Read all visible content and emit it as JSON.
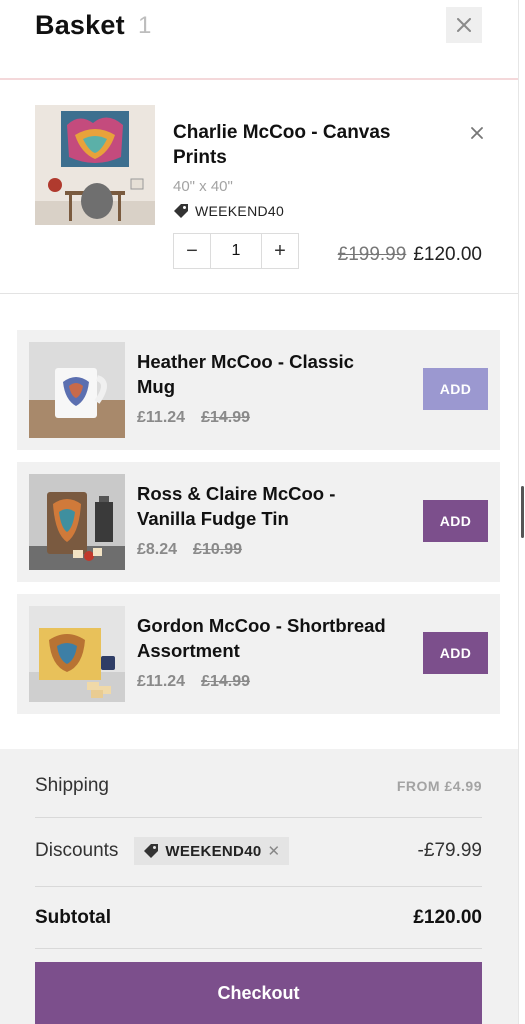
{
  "header": {
    "title": "Basket",
    "count": "1"
  },
  "cart_item": {
    "name": "Charlie McCoo - Canvas Prints",
    "variant": "40\" x 40\"",
    "coupon": "WEEKEND40",
    "quantity": "1",
    "price_old": "£199.99",
    "price_new": "£120.00"
  },
  "upsells": [
    {
      "name": "Heather McCoo - Classic Mug",
      "price": "£11.24",
      "price_old": "£14.99",
      "button": "ADD",
      "button_color": "#9b98d0"
    },
    {
      "name": "Ross & Claire McCoo - Vanilla Fudge Tin",
      "price": "£8.24",
      "price_old": "£10.99",
      "button": "ADD",
      "button_color": "#7c4f8c"
    },
    {
      "name": "Gordon McCoo - Shortbread Assortment",
      "price": "£11.24",
      "price_old": "£14.99",
      "button": "ADD",
      "button_color": "#7c4f8c"
    }
  ],
  "totals": {
    "shipping_label": "Shipping",
    "shipping_value": "FROM £4.99",
    "discounts_label": "Discounts",
    "discount_code": "WEEKEND40",
    "discount_value": "-£79.99",
    "subtotal_label": "Subtotal",
    "subtotal_value": "£120.00"
  },
  "checkout": {
    "label": "Checkout",
    "color": "#7c4f8c"
  },
  "icons": {
    "close": "close-icon",
    "remove": "remove-icon",
    "tag": "tag-icon",
    "minus": "minus-icon",
    "plus": "plus-icon"
  }
}
